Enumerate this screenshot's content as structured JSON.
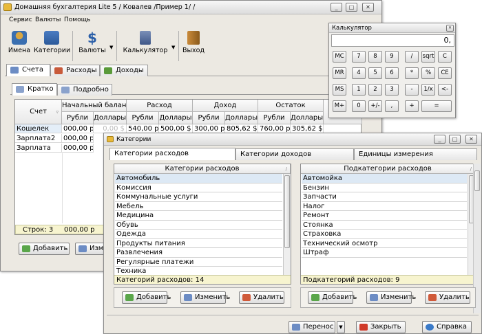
{
  "main": {
    "title": "Домашняя бухгалтерия Lite 5  / Ковалев /Пример 1/ /",
    "menu": [
      "Сервис",
      "Валюты",
      "Помощь"
    ],
    "toolbar": [
      "Имена",
      "Категории",
      "Валюты",
      "Калькулятор",
      "Выход"
    ],
    "tabs": [
      "Счета",
      "Расходы",
      "Доходы"
    ],
    "subtabs": [
      "Кратко",
      "Подробно"
    ],
    "grid": {
      "col_account": "Счет",
      "groups": [
        "Начальный баланс",
        "Расход",
        "Доход",
        "Остаток"
      ],
      "subcols": [
        "Рубли",
        "Доллары",
        "Рубли",
        "Доллары",
        "Рубли",
        "Доллары",
        "Рубли",
        "Доллары"
      ],
      "rows": [
        {
          "name": "Кошелек",
          "values": [
            "000,00 р",
            "0,00 $",
            "540,00 р",
            "500,00 $",
            "300,00 р",
            "805,62 $",
            "760,00 р",
            "305,62 $"
          ]
        },
        {
          "name": "Зарплата2",
          "values": [
            "000,00 р",
            "",
            "",
            "",
            "",
            "",
            "",
            ""
          ]
        },
        {
          "name": "Зарплата",
          "values": [
            "000,00 р",
            "",
            "",
            "",
            "",
            "",
            "",
            ""
          ]
        }
      ],
      "footer_label": "Строк: 3",
      "footer_value": "000,00 р"
    },
    "buttons": {
      "add": "Добавить",
      "edit": "Изме"
    }
  },
  "calculator": {
    "title": "Калькулятор",
    "display": "0,",
    "keys": [
      [
        "MC",
        "7",
        "8",
        "9",
        "/",
        "sqrt",
        "C"
      ],
      [
        "MR",
        "4",
        "5",
        "6",
        "*",
        "%",
        "CE"
      ],
      [
        "MS",
        "1",
        "2",
        "3",
        "-",
        "1/x",
        "<-"
      ],
      [
        "M+",
        "0",
        "+/-",
        ",",
        "+",
        "="
      ]
    ]
  },
  "categories": {
    "title": "Категории",
    "tabs": [
      "Категории расходов",
      "Категории доходов",
      "Единицы измерения"
    ],
    "left": {
      "header": "Категории расходов",
      "items": [
        "Автомобиль",
        "Комиссия",
        "Коммунальные услуги",
        "Мебель",
        "Медицина",
        "Обувь",
        "Одежда",
        "Продукты питания",
        "Развлечения",
        "Регулярные платежи",
        "Техника"
      ],
      "footer": "Категорий расходов: 14"
    },
    "right": {
      "header": "Подкатегории расходов",
      "items": [
        "Автомойка",
        "Бензин",
        "Запчасти",
        "Налог",
        "Ремонт",
        "Стоянка",
        "Страховка",
        "Технический осмотр",
        "Штраф"
      ],
      "footer": "Подкатегорий расходов: 9"
    },
    "buttons": {
      "add": "Добавить",
      "edit": "Изменить",
      "delete": "Удалить"
    },
    "bottom": {
      "transfer": "Перенос",
      "close": "Закрыть",
      "help": "Справка"
    }
  }
}
